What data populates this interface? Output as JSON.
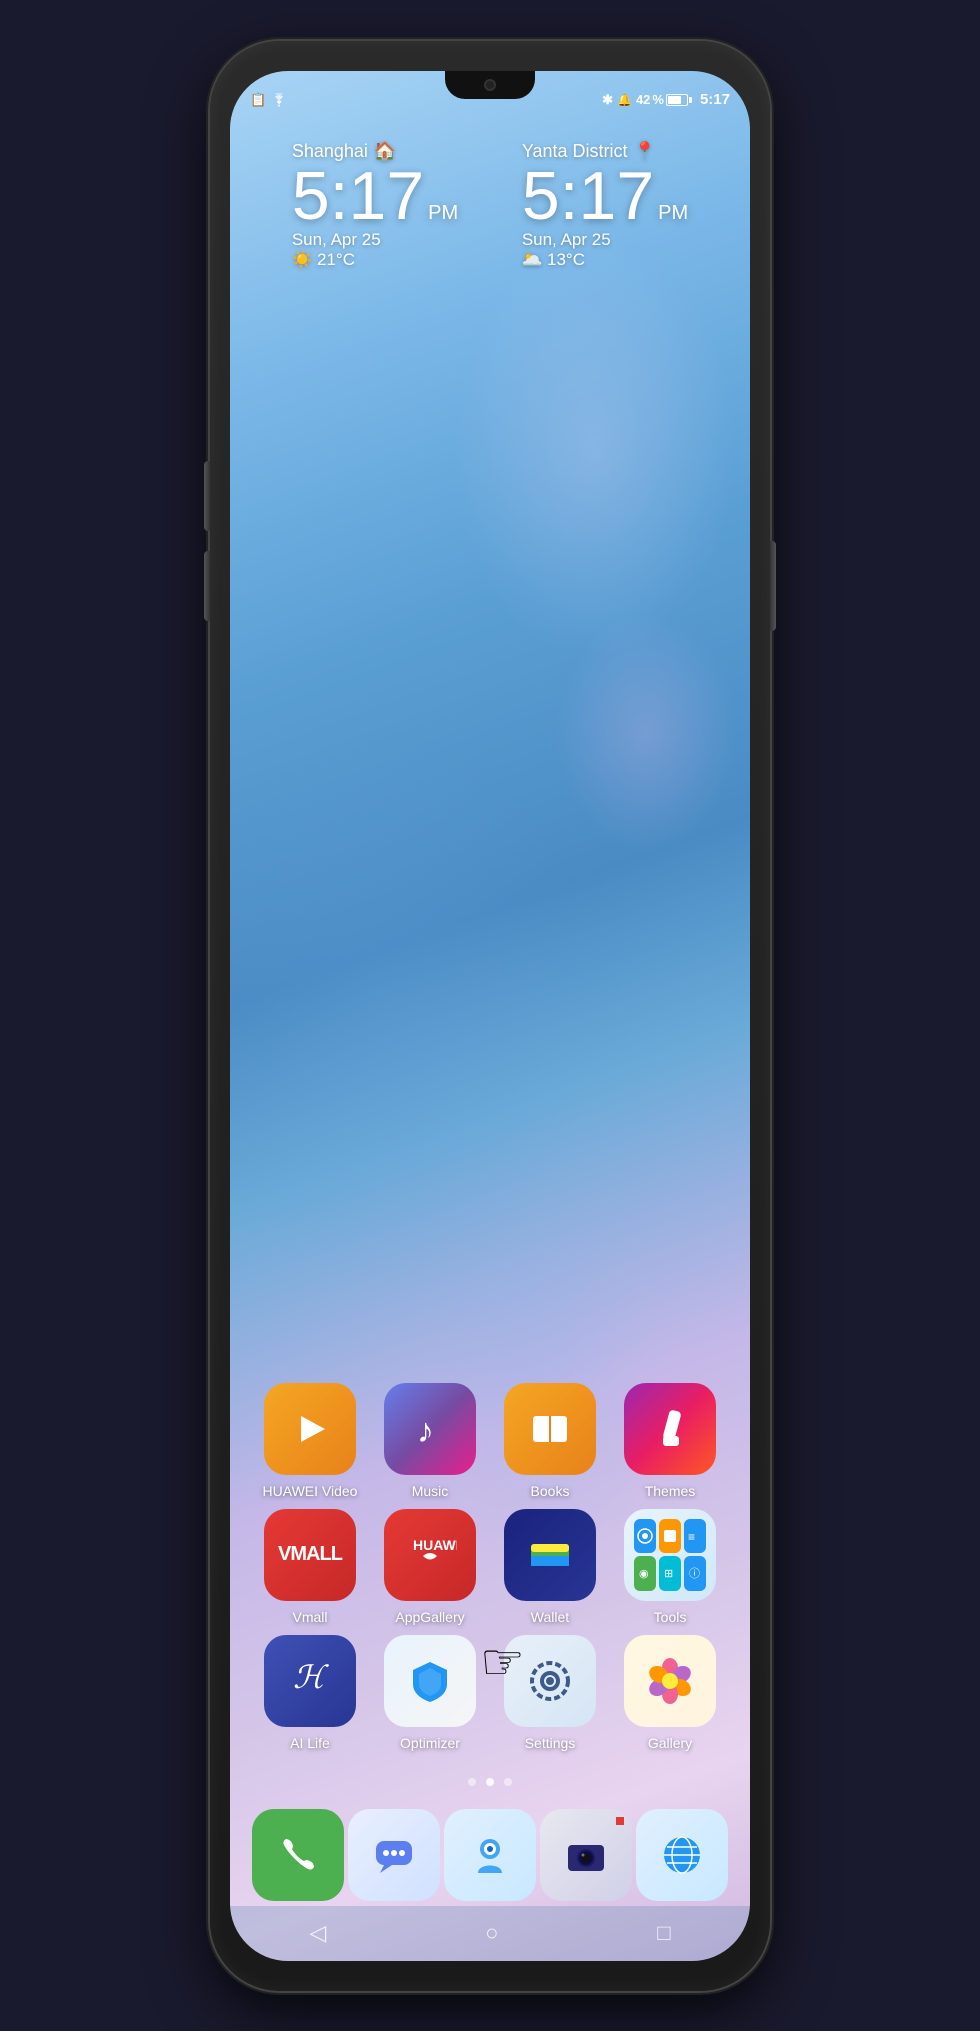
{
  "phone": {
    "status_bar": {
      "time": "5:17",
      "battery": "42",
      "icons_left": [
        "sim-icon",
        "wifi-icon"
      ],
      "icons_right": [
        "bluetooth-icon",
        "alarm-icon",
        "battery-icon",
        "time-icon"
      ]
    },
    "clock_left": {
      "city": "Shanghai",
      "time": "5:17",
      "ampm": "PM",
      "date": "Sun, Apr 25",
      "weather_icon": "☀️",
      "temp": "21°C"
    },
    "clock_right": {
      "city": "Yanta District",
      "time": "5:17",
      "ampm": "PM",
      "date": "Sun, Apr 25",
      "weather_icon": "🌥️",
      "temp": "13°C"
    },
    "app_rows": [
      [
        {
          "id": "huawei-video",
          "label": "HUAWEI Video",
          "icon_type": "huawei-video"
        },
        {
          "id": "music",
          "label": "Music",
          "icon_type": "music"
        },
        {
          "id": "books",
          "label": "Books",
          "icon_type": "books"
        },
        {
          "id": "themes",
          "label": "Themes",
          "icon_type": "themes"
        }
      ],
      [
        {
          "id": "vmall",
          "label": "Vmall",
          "icon_type": "vmall"
        },
        {
          "id": "appgallery",
          "label": "AppGallery",
          "icon_type": "appgallery"
        },
        {
          "id": "wallet",
          "label": "Wallet",
          "icon_type": "wallet"
        },
        {
          "id": "tools",
          "label": "Tools",
          "icon_type": "tools"
        }
      ],
      [
        {
          "id": "ailife",
          "label": "AI Life",
          "icon_type": "ailife"
        },
        {
          "id": "optimizer",
          "label": "Optimizer",
          "icon_type": "optimizer"
        },
        {
          "id": "settings",
          "label": "Settings",
          "icon_type": "settings"
        },
        {
          "id": "gallery",
          "label": "Gallery",
          "icon_type": "gallery"
        }
      ]
    ],
    "page_dots": [
      {
        "active": false
      },
      {
        "active": true
      },
      {
        "active": false
      }
    ],
    "dock": [
      {
        "id": "phone",
        "icon_type": "phone"
      },
      {
        "id": "messages",
        "icon_type": "messages"
      },
      {
        "id": "assistant",
        "icon_type": "assistant"
      },
      {
        "id": "camera",
        "icon_type": "camera"
      },
      {
        "id": "browser",
        "icon_type": "browser"
      }
    ],
    "nav": {
      "back": "◁",
      "home": "○",
      "recents": "□"
    }
  }
}
